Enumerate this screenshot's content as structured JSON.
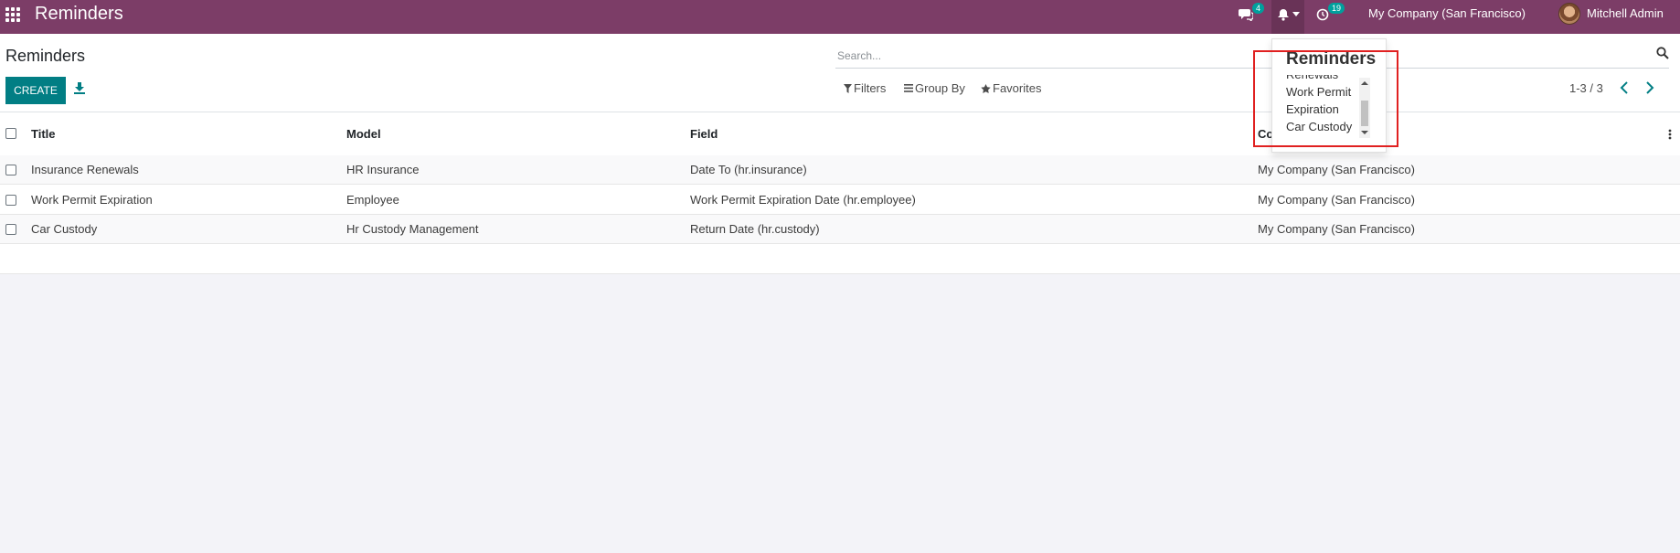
{
  "navbar": {
    "app_title": "Reminders",
    "messages_badge": "4",
    "activity_badge": "19",
    "company": "My Company (San Francisco)",
    "user": "Mitchell Admin",
    "bg_color": "#7c3d67"
  },
  "control_panel": {
    "title": "Reminders",
    "create_label": "CREATE",
    "search_placeholder": "Search...",
    "filters_label": "Filters",
    "group_by_label": "Group By",
    "favorites_label": "Favorites",
    "pager_value": "1-3 / 3"
  },
  "list": {
    "columns": [
      "Title",
      "Model",
      "Field",
      "Co"
    ],
    "rows": [
      {
        "title": "Insurance Renewals",
        "model": "HR Insurance",
        "field": "Date To (hr.insurance)",
        "company": "My Company (San Francisco)"
      },
      {
        "title": "Work Permit Expiration",
        "model": "Employee",
        "field": "Work Permit Expiration Date (hr.employee)",
        "company": "My Company (San Francisco)"
      },
      {
        "title": "Car Custody",
        "model": "Hr Custody Management",
        "field": "Return Date (hr.custody)",
        "company": "My Company (San Francisco)"
      }
    ]
  },
  "reminders_dropdown": {
    "title": "Reminders",
    "items": [
      "Renewals",
      "Work Permit",
      "Expiration",
      "Car Custody"
    ]
  },
  "colors": {
    "accent": "#017e84",
    "badge": "#00a09d",
    "highlight": "#e02020"
  },
  "icons": [
    "apps-icon",
    "chat-icon",
    "bell-icon",
    "clock-icon",
    "download-icon",
    "search-icon",
    "filter-icon",
    "group-by-icon",
    "star-icon",
    "chevron-left-icon",
    "chevron-right-icon",
    "column-options-icon"
  ]
}
